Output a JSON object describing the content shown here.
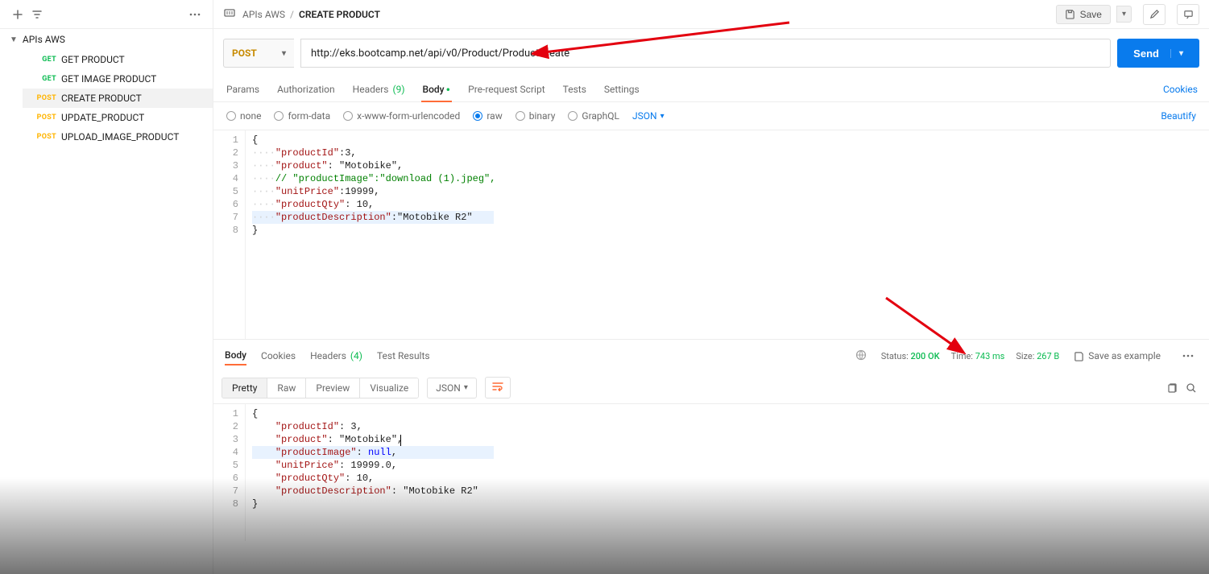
{
  "sidebar": {
    "collection": "APIs AWS",
    "items": [
      {
        "method": "GET",
        "label": "GET PRODUCT",
        "active": false
      },
      {
        "method": "GET",
        "label": "GET IMAGE PRODUCT",
        "active": false
      },
      {
        "method": "POST",
        "label": "CREATE PRODUCT",
        "active": true
      },
      {
        "method": "POST",
        "label": "UPDATE_PRODUCT",
        "active": false
      },
      {
        "method": "POST",
        "label": "UPLOAD_IMAGE_PRODUCT",
        "active": false
      }
    ]
  },
  "breadcrumb": {
    "parent": "APIs AWS",
    "current": "CREATE PRODUCT"
  },
  "toolbar": {
    "save": "Save"
  },
  "request": {
    "method": "POST",
    "url": "http://eks.bootcamp.net/api/v0/Product/ProductCreate",
    "send": "Send",
    "tabs": {
      "params": "Params",
      "authorization": "Authorization",
      "headers": "Headers",
      "headers_count": "(9)",
      "body": "Body",
      "prerequest": "Pre-request Script",
      "tests": "Tests",
      "settings": "Settings",
      "cookies_link": "Cookies"
    },
    "body_types": {
      "none": "none",
      "form_data": "form-data",
      "x_www": "x-www-form-urlencoded",
      "raw": "raw",
      "binary": "binary",
      "graphql": "GraphQL",
      "format": "JSON",
      "beautify": "Beautify"
    },
    "body_lines": [
      "{",
      "····\"productId\":3,",
      "····\"product\": \"Motobike\",",
      "····// \"productImage\":\"download (1).jpeg\",",
      "····\"unitPrice\":19999,",
      "····\"productQty\": 10,",
      "····\"productDescription\":\"Motobike R2\"",
      "}"
    ]
  },
  "response": {
    "tabs": {
      "body": "Body",
      "cookies": "Cookies",
      "headers": "Headers",
      "headers_count": "(4)",
      "test_results": "Test Results"
    },
    "meta": {
      "status_label": "Status:",
      "status_value": "200 OK",
      "time_label": "Time:",
      "time_value": "743 ms",
      "size_label": "Size:",
      "size_value": "267 B",
      "save_example": "Save as example"
    },
    "view": {
      "pretty": "Pretty",
      "raw": "Raw",
      "preview": "Preview",
      "visualize": "Visualize",
      "format": "JSON"
    },
    "body_lines": [
      "{",
      "    \"productId\": 3,",
      "    \"product\": \"Motobike\",",
      "    \"productImage\": null,",
      "    \"unitPrice\": 19999.0,",
      "    \"productQty\": 10,",
      "    \"productDescription\": \"Motobike R2\"",
      "}"
    ]
  }
}
